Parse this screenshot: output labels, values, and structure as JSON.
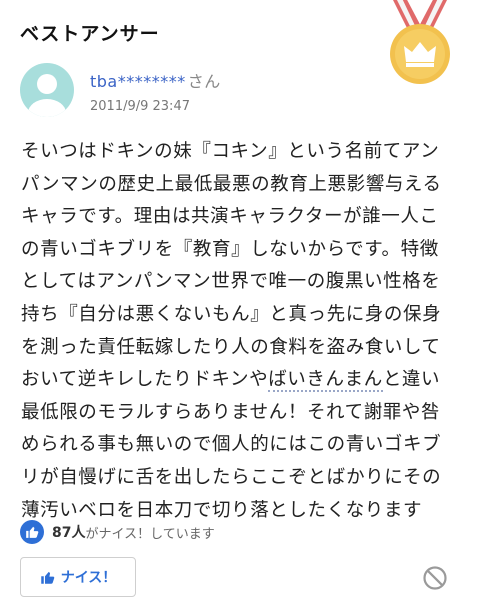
{
  "header": {
    "title": "ベストアンサー"
  },
  "user": {
    "name": "tba********",
    "suffix": "さん",
    "date": "2011/9/9 23:47"
  },
  "answer": {
    "lines": [
      "そいつはドキンの妹『コキン』という名前てアン",
      "パンマンの歴史上最低最悪の教育上悪影響与える",
      "キャラです。理由は共演キャラクターが誰一人こ",
      "の青いゴキブリを『教育』しないからです。特徴",
      "としてはアンパンマン世界で唯一の腹黒い性格を",
      "持ち『自分は悪くないもん』と真っ先に身の保身",
      "を測った責任転嫁したり人の食料を盗み食いして",
      "おいて逆キレしたりドキンや",
      "最低限のモラルすらありません！それて謝罪や咎",
      "められる事も無いので個人的にはこの青いゴキブ",
      "リが自慢げに舌を出したらここぞとばかりにその",
      "薄汚いベロを日本刀で切り落としたくなります"
    ],
    "link_text": "ばいきんまん",
    "line8_tail": "と違い"
  },
  "nice": {
    "count": "87人",
    "count_suffix": "がナイス！しています",
    "button_label": "ナイス！"
  },
  "icons": {
    "medal": "medal-crown-icon",
    "thumb": "thumbs-up-icon",
    "block": "block-icon"
  },
  "colors": {
    "accent": "#2e6fd6",
    "medal_gold": "#f2c14e",
    "ribbon": "#e06a6a",
    "avatar_bg": "#a8dedc"
  }
}
